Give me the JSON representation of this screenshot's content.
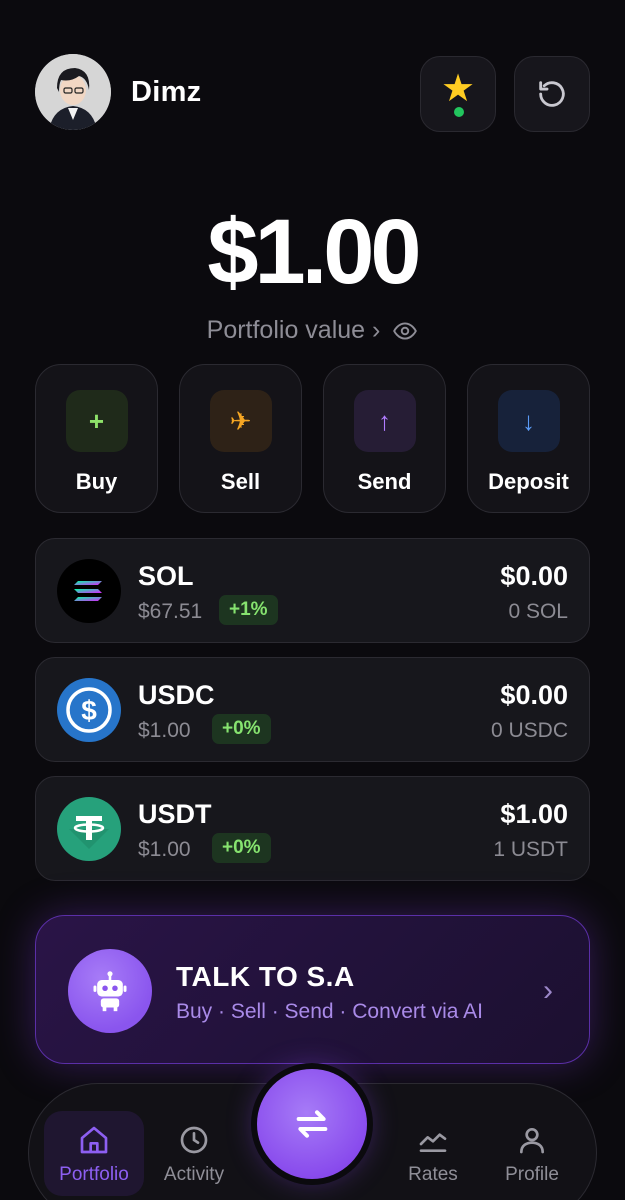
{
  "header": {
    "username": "Dimz",
    "star_icon": "star-icon",
    "refresh_icon": "refresh-icon"
  },
  "balance": {
    "value": "$1.00",
    "label": "Portfolio value ›"
  },
  "actions": [
    {
      "label": "Buy",
      "glyph": "+"
    },
    {
      "label": "Sell",
      "glyph": "✈"
    },
    {
      "label": "Send",
      "glyph": "↑"
    },
    {
      "label": "Deposit",
      "glyph": "↓"
    }
  ],
  "assets": [
    {
      "name": "SOL",
      "price": "$67.51",
      "change": "+1%",
      "fiat": "$0.00",
      "amount": "0 SOL"
    },
    {
      "name": "USDC",
      "price": "$1.00",
      "change": "+0%",
      "fiat": "$0.00",
      "amount": "0 USDC"
    },
    {
      "name": "USDT",
      "price": "$1.00",
      "change": "+0%",
      "fiat": "$1.00",
      "amount": "1 USDT"
    }
  ],
  "ai_banner": {
    "title": "TALK TO S.A",
    "subtitle": "Buy · Sell · Send · Convert via AI",
    "chevron": "›"
  },
  "nav": {
    "portfolio": "Portfolio",
    "activity": "Activity",
    "rates": "Rates",
    "profile": "Profile"
  },
  "colors": {
    "accent": "#8b55ee",
    "positive": "#86e36f",
    "background": "#0b0a0e"
  }
}
